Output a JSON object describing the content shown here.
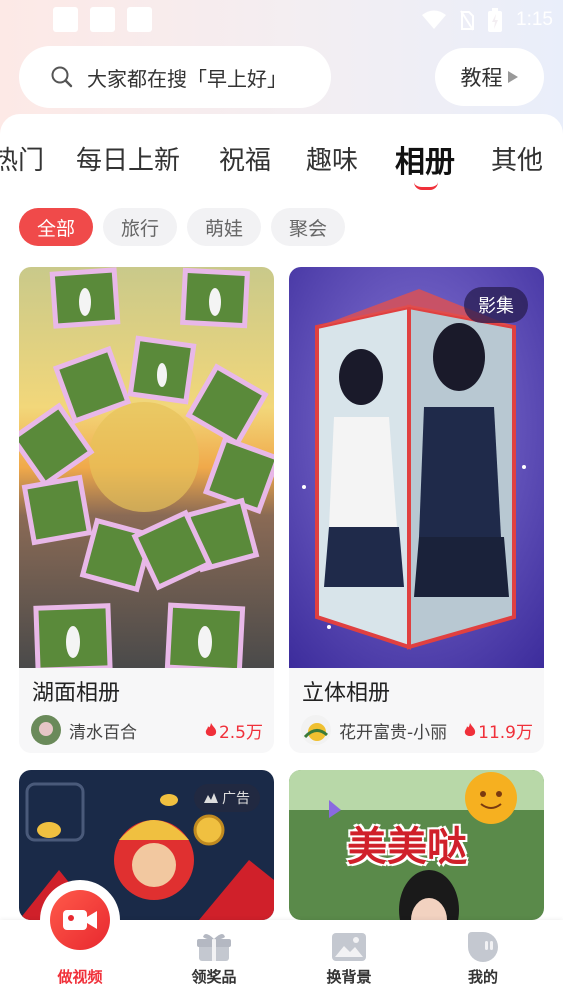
{
  "status_bar": {
    "time": "1:15"
  },
  "search": {
    "text": "大家都在搜「早上好」"
  },
  "tutorial": {
    "label": "教程"
  },
  "categories": [
    "热门",
    "每日上新",
    "祝福",
    "趣味",
    "相册",
    "其他"
  ],
  "active_category": "相册",
  "chips": [
    "全部",
    "旅行",
    "萌娃",
    "聚会"
  ],
  "active_chip": "全部",
  "cards": [
    {
      "title": "湖面相册",
      "author": "清水百合",
      "likes": "2.5万"
    },
    {
      "title": "立体相册",
      "author": "花开富贵-小丽",
      "likes": "11.9万",
      "badge": "影集"
    }
  ],
  "partial_cards": [
    {
      "tag": "广告"
    },
    {
      "overlay_text": "美美哒"
    }
  ],
  "bottom_nav": [
    {
      "label": "做视频",
      "icon": "video-camera-icon"
    },
    {
      "label": "领奖品",
      "icon": "gift-icon"
    },
    {
      "label": "换背景",
      "icon": "picture-icon"
    },
    {
      "label": "我的",
      "icon": "profile-icon"
    }
  ],
  "colors": {
    "accent": "#f0303a",
    "chip_inactive": "#f2f2f4"
  }
}
